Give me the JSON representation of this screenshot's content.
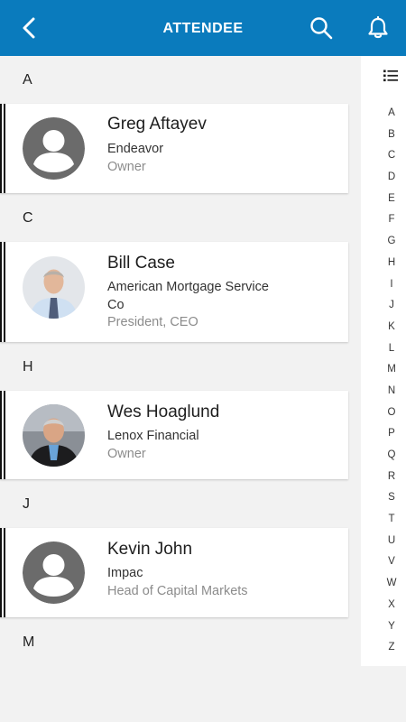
{
  "header": {
    "title": "ATTENDEE"
  },
  "sections": [
    {
      "letter": "A",
      "name": "Greg Aftayev",
      "company": "Endeavor",
      "role": "Owner"
    },
    {
      "letter": "C",
      "name": "Bill Case",
      "company": "American Mortgage Service Co",
      "role": "President, CEO"
    },
    {
      "letter": "H",
      "name": "Wes Hoaglund",
      "company": "Lenox Financial",
      "role": "Owner"
    },
    {
      "letter": "J",
      "name": "Kevin John",
      "company": "Impac",
      "role": "Head of Capital Markets"
    },
    {
      "letter": "M"
    }
  ],
  "index": [
    "A",
    "B",
    "C",
    "D",
    "E",
    "F",
    "G",
    "H",
    "I",
    "J",
    "K",
    "L",
    "M",
    "N",
    "O",
    "P",
    "Q",
    "R",
    "S",
    "T",
    "U",
    "V",
    "W",
    "X",
    "Y",
    "Z"
  ],
  "colors": {
    "accent": "#0a7bbd"
  }
}
